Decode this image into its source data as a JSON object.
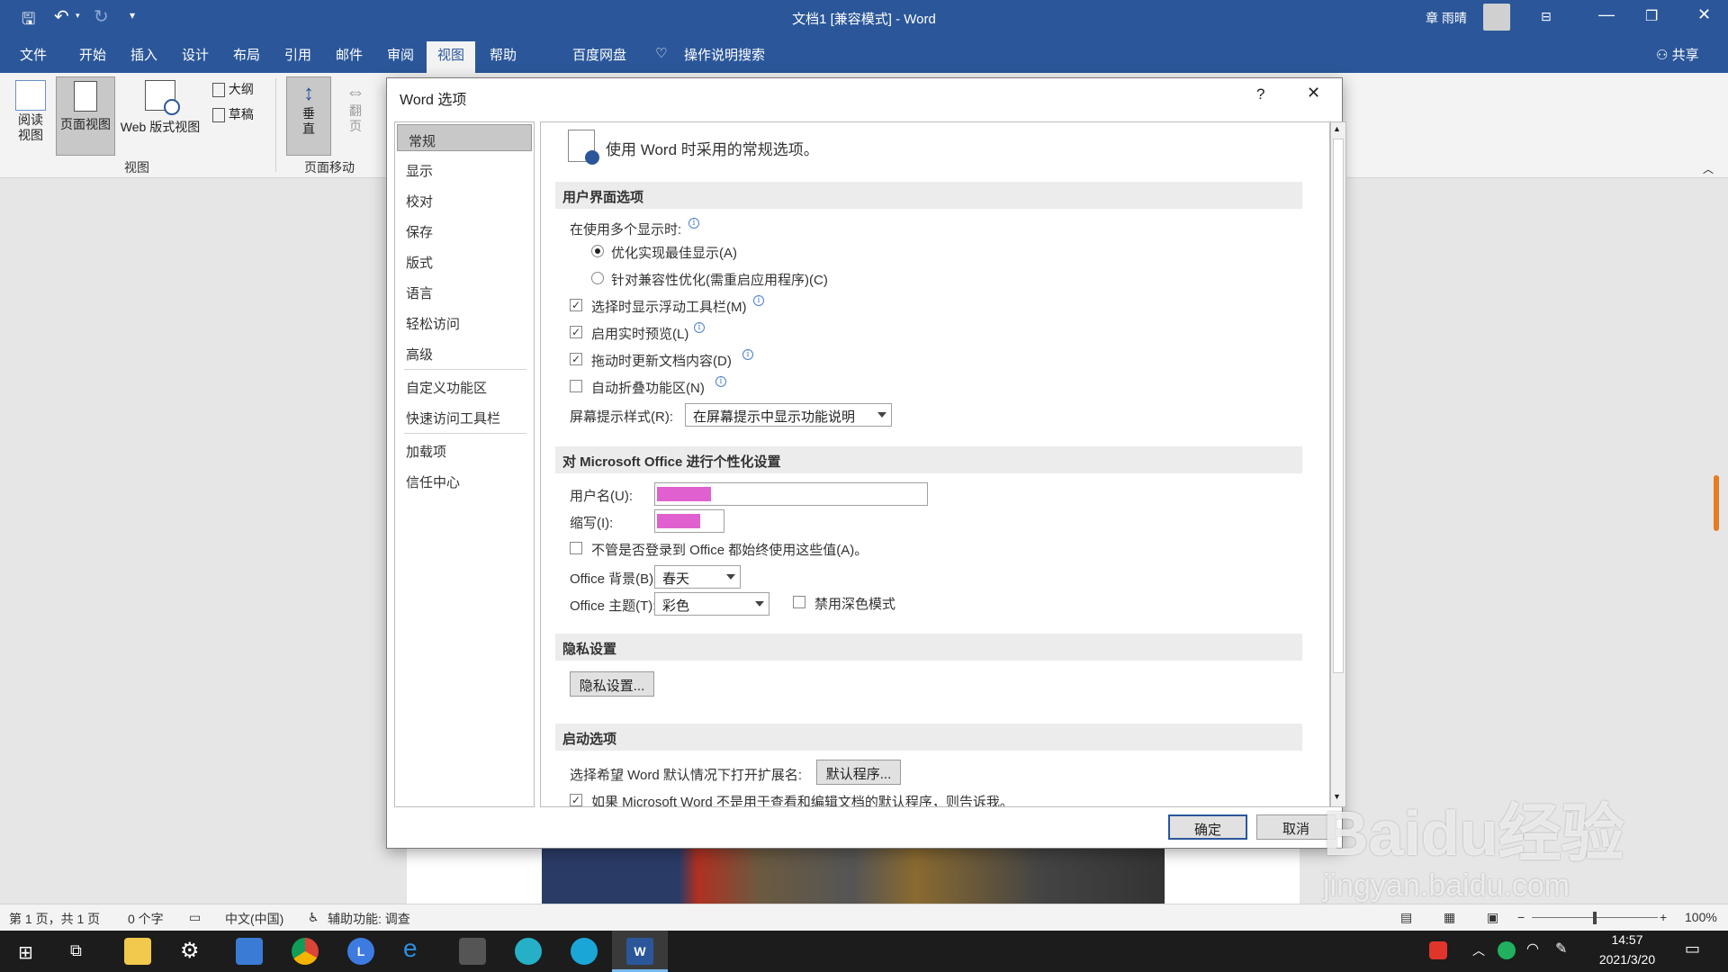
{
  "window": {
    "title": "文档1 [兼容模式]  -  Word",
    "user": "章 雨晴",
    "share": "共享"
  },
  "ribbon_tabs": [
    "文件",
    "开始",
    "插入",
    "设计",
    "布局",
    "引用",
    "邮件",
    "审阅",
    "视图",
    "帮助",
    "百度网盘",
    "操作说明搜索"
  ],
  "active_tab": "视图",
  "ribbon": {
    "read_view": "阅读\n视图",
    "print_layout": "页面视图",
    "web_layout": "Web 版式视图",
    "outline": "大纲",
    "draft": "草稿",
    "group_views": "视图",
    "vertical": "垂\n直",
    "side_to_side": "翻\n页",
    "group_page_movement": "页面移动"
  },
  "dialog": {
    "title": "Word 选项",
    "help": "?",
    "close": "✕",
    "nav": [
      "常规",
      "显示",
      "校对",
      "保存",
      "版式",
      "语言",
      "轻松访问",
      "高级",
      "自定义功能区",
      "快速访问工具栏",
      "加载项",
      "信任中心"
    ],
    "header": "使用 Word 时采用的常规选项。",
    "ui_section": "用户界面选项",
    "multi_display": "在使用多个显示时:",
    "opt_best": "优化实现最佳显示(A)",
    "opt_compat": "针对兼容性优化(需重启应用程序)(C)",
    "cb_minitoolbar": "选择时显示浮动工具栏(M)",
    "cb_livepreview": "启用实时预览(L)",
    "cb_update_drag": "拖动时更新文档内容(D)",
    "cb_collapse": "自动折叠功能区(N)",
    "screentip_label": "屏幕提示样式(R):",
    "screentip_value": "在屏幕提示中显示功能说明",
    "personal_section": "对 Microsoft Office 进行个性化设置",
    "username_label": "用户名(U):",
    "initials_label": "缩写(I):",
    "cb_always_use": "不管是否登录到 Office 都始终使用这些值(A)。",
    "bg_label": "Office 背景(B):",
    "bg_value": "春天",
    "theme_label": "Office 主题(T):",
    "theme_value": "彩色",
    "cb_dark": "禁用深色模式",
    "privacy_section": "隐私设置",
    "privacy_btn": "隐私设置...",
    "startup_section": "启动选项",
    "ext_label": "选择希望 Word 默认情况下打开扩展名:",
    "ext_btn": "默认程序...",
    "cb_tell_me": "如果 Microsoft Word 不是用于查看和编辑文档的默认程序，则告诉我。",
    "ok": "确定",
    "cancel": "取消"
  },
  "status": {
    "page": "第 1 页，共 1 页",
    "words": "0 个字",
    "lang": "中文(中国)",
    "access": "辅助功能: 调查",
    "zoom": "100%"
  },
  "taskbar": {
    "time": "14:57",
    "date": "2021/3/20"
  },
  "watermark": "Baidu经验",
  "watermark_url": "jingyan.baidu.com"
}
